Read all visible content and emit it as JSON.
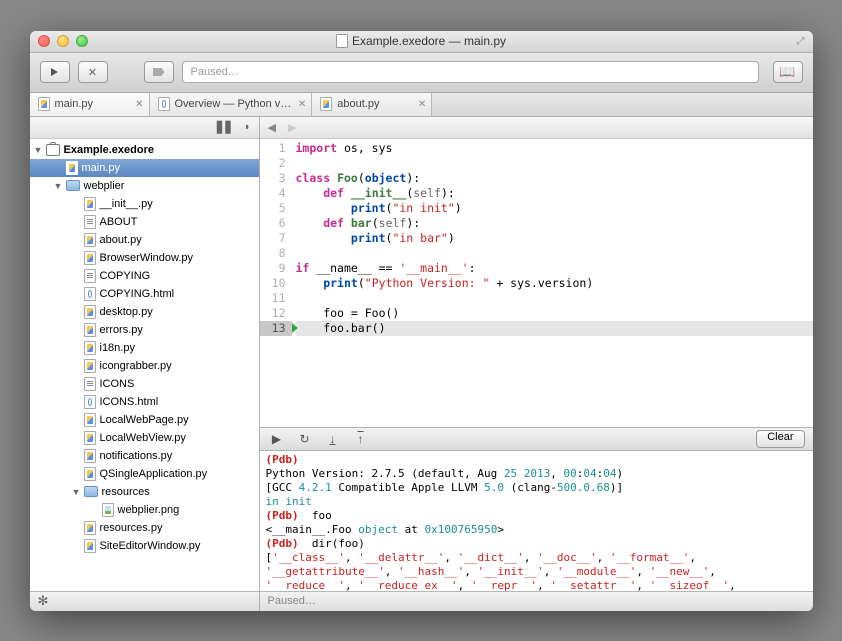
{
  "window": {
    "title": "Example.exedore — main.py"
  },
  "toolbar": {
    "search_placeholder": "Paused…",
    "clear_label": "Clear"
  },
  "tabs": [
    {
      "label": "main.py",
      "type": "py"
    },
    {
      "label": "Overview — Python v…",
      "type": "html"
    },
    {
      "label": "about.py",
      "type": "py"
    }
  ],
  "sidebar": {
    "project": "Example.exedore",
    "tree": [
      {
        "label": "main.py",
        "type": "py",
        "depth": 1,
        "sel": true
      },
      {
        "label": "webplier",
        "type": "folder",
        "depth": 1,
        "arrow": "▼"
      },
      {
        "label": "__init__.py",
        "type": "py",
        "depth": 2
      },
      {
        "label": "ABOUT",
        "type": "txt",
        "depth": 2
      },
      {
        "label": "about.py",
        "type": "py",
        "depth": 2
      },
      {
        "label": "BrowserWindow.py",
        "type": "py",
        "depth": 2
      },
      {
        "label": "COPYING",
        "type": "txt",
        "depth": 2
      },
      {
        "label": "COPYING.html",
        "type": "html",
        "depth": 2
      },
      {
        "label": "desktop.py",
        "type": "py",
        "depth": 2
      },
      {
        "label": "errors.py",
        "type": "py",
        "depth": 2
      },
      {
        "label": "i18n.py",
        "type": "py",
        "depth": 2
      },
      {
        "label": "icongrabber.py",
        "type": "py",
        "depth": 2
      },
      {
        "label": "ICONS",
        "type": "txt",
        "depth": 2
      },
      {
        "label": "ICONS.html",
        "type": "html",
        "depth": 2
      },
      {
        "label": "LocalWebPage.py",
        "type": "py",
        "depth": 2
      },
      {
        "label": "LocalWebView.py",
        "type": "py",
        "depth": 2
      },
      {
        "label": "notifications.py",
        "type": "py",
        "depth": 2
      },
      {
        "label": "QSingleApplication.py",
        "type": "py",
        "depth": 2
      },
      {
        "label": "resources",
        "type": "folder",
        "depth": 2,
        "arrow": "▼"
      },
      {
        "label": "webplier.png",
        "type": "img",
        "depth": 3
      },
      {
        "label": "resources.py",
        "type": "py",
        "depth": 2
      },
      {
        "label": "SiteEditorWindow.py",
        "type": "py",
        "depth": 2
      }
    ]
  },
  "code": {
    "lines": [
      {
        "n": 1,
        "html": "<span class='kw'>import</span> os, sys"
      },
      {
        "n": 2,
        "html": ""
      },
      {
        "n": 3,
        "html": "<span class='kw'>class</span> <span class='fn'>Foo</span>(<span class='kw2'>object</span>):"
      },
      {
        "n": 4,
        "html": "    <span class='kw'>def</span> <span class='fn'>__init__</span>(<span class='sf'>self</span>):"
      },
      {
        "n": 5,
        "html": "        <span class='kw2'>print</span>(<span class='str'>\"in init\"</span>)"
      },
      {
        "n": 6,
        "html": "    <span class='kw'>def</span> <span class='fn'>bar</span>(<span class='sf'>self</span>):"
      },
      {
        "n": 7,
        "html": "        <span class='kw2'>print</span>(<span class='str'>\"in bar\"</span>)"
      },
      {
        "n": 8,
        "html": ""
      },
      {
        "n": 9,
        "html": "<span class='kw'>if</span> __name__ == <span class='str'>'__main__'</span>:"
      },
      {
        "n": 10,
        "html": "    <span class='kw2'>print</span>(<span class='str'>\"Python Version: \"</span> + sys.version)"
      },
      {
        "n": 11,
        "html": ""
      },
      {
        "n": 12,
        "html": "    foo = Foo()"
      },
      {
        "n": 13,
        "html": "    foo.bar()",
        "bp": true
      }
    ]
  },
  "console_html": "<span class='pdb'>(Pdb)</span>\nPython Version: 2.7.5 (default, Aug <span class='cy'>25</span> <span class='cy'>2013</span>, <span class='cy'>00</span>:<span class='cy'>04</span>:<span class='cy'>04</span>)\n[GCC <span class='cy'>4.2.1</span> Compatible Apple LLVM <span class='cy'>5.0</span> (clang-<span class='cy'>500.0.68</span>)]\n<span class='cy'>in</span> <span class='cy'>init</span>\n<span class='pdb'>(Pdb)</span>  foo\n&lt;__main__.Foo <span class='cy'>object</span> at <span class='cy'>0x100765950</span>&gt;\n<span class='pdb'>(Pdb)</span>  dir(foo)\n[<span class='red'>'__class__'</span>, <span class='red'>'__delattr__'</span>, <span class='red'>'__dict__'</span>, <span class='red'>'__doc__'</span>, <span class='red'>'__format__'</span>, <span class='red'>'__getattribute__'</span>, <span class='red'>'__hash__'</span>, <span class='red'>'__init__'</span>, <span class='red'>'__module__'</span>, <span class='red'>'__new__'</span>, <span class='red'>'__reduce__'</span>, <span class='red'>'__reduce_ex__'</span>, <span class='red'>'__repr__'</span>, <span class='red'>'__setattr__'</span>, <span class='red'>'__sizeof__'</span>, <span class='red'>'__str__'</span>, <span class='red'>'__subclasshook__'</span>, <span class='red'>'__weakref__'</span>, <span class='red'>'bar'</span>]\n<span class='pdb'>(Pdb)</span> |",
  "status": {
    "main": "Paused…"
  }
}
